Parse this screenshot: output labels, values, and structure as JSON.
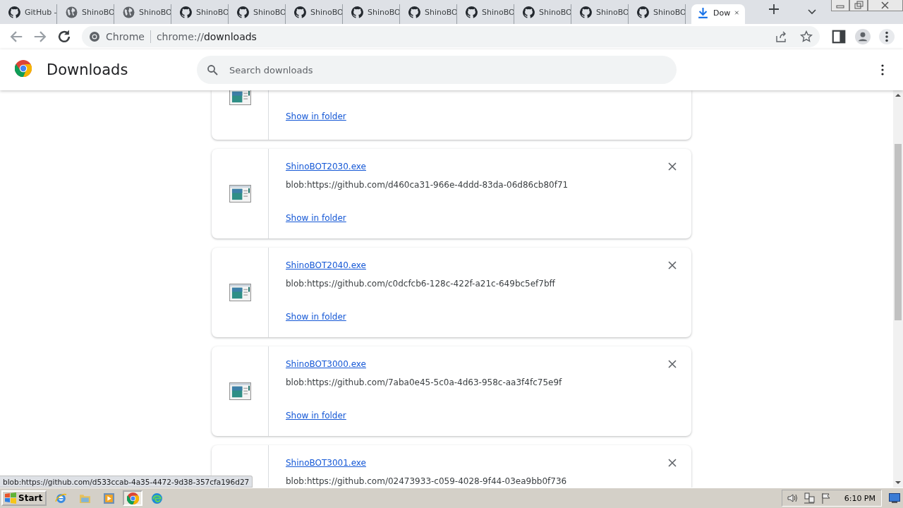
{
  "tabs": [
    {
      "title": "GitHub -",
      "kind": "github",
      "selected": false
    },
    {
      "title": "ShinoBO",
      "kind": "globe",
      "selected": false
    },
    {
      "title": "ShinoBO",
      "kind": "globe",
      "selected": false
    },
    {
      "title": "ShinoBO",
      "kind": "github",
      "selected": false
    },
    {
      "title": "ShinoBO",
      "kind": "github",
      "selected": false
    },
    {
      "title": "ShinoBO",
      "kind": "github",
      "selected": false
    },
    {
      "title": "ShinoBO",
      "kind": "github",
      "selected": false
    },
    {
      "title": "ShinoBO",
      "kind": "github",
      "selected": false
    },
    {
      "title": "ShinoBO",
      "kind": "github",
      "selected": false
    },
    {
      "title": "ShinoBO",
      "kind": "github",
      "selected": false
    },
    {
      "title": "ShinoBO",
      "kind": "github",
      "selected": false
    },
    {
      "title": "ShinoBO",
      "kind": "github",
      "selected": false
    },
    {
      "title": "Dow",
      "kind": "download",
      "selected": true
    }
  ],
  "toolbar": {
    "site_label": "Chrome",
    "url_host": "chrome://",
    "url_path": "downloads"
  },
  "header": {
    "title": "Downloads",
    "search": {
      "placeholder": "Search downloads"
    }
  },
  "downloads": [
    {
      "kind": "partial",
      "action": "Show in folder"
    },
    {
      "kind": "full",
      "file_name": "ShinoBOT2030.exe",
      "url": "blob:https://github.com/d460ca31-966e-4ddd-83da-06d86cb80f71",
      "action": "Show in folder"
    },
    {
      "kind": "full",
      "file_name": "ShinoBOT2040.exe",
      "url": "blob:https://github.com/c0dcfcb6-128c-422f-a21c-649bc5ef7bff",
      "action": "Show in folder"
    },
    {
      "kind": "full",
      "file_name": "ShinoBOT3000.exe",
      "url": "blob:https://github.com/7aba0e45-5c0a-4d63-958c-aa3f4fc75e9f",
      "action": "Show in folder"
    },
    {
      "kind": "cut",
      "file_name": "ShinoBOT3001.exe",
      "url": "blob:https://github.com/02473933-c059-4028-9f44-03ea9bb0f736"
    }
  ],
  "status_bubble": "blob:https://github.com/d533ccab-4a35-4472-9d38-357cfa196d27",
  "taskbar": {
    "start": "Start",
    "apps": [
      {
        "kind": "ie",
        "selected": false
      },
      {
        "kind": "folder",
        "selected": false
      },
      {
        "kind": "media",
        "selected": false
      },
      {
        "kind": "chrome",
        "selected": true
      },
      {
        "kind": "edge",
        "selected": false
      }
    ],
    "clock": "6:10 PM"
  }
}
